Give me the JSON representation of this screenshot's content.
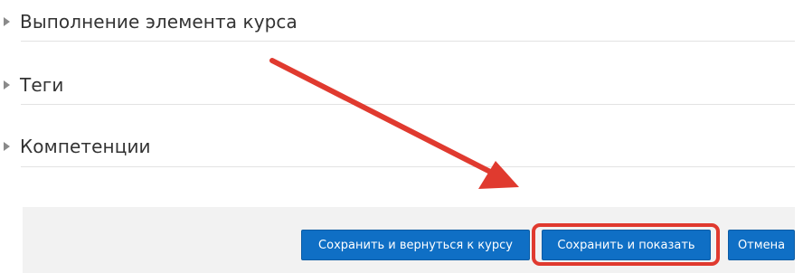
{
  "sections": [
    {
      "label": "Выполнение элемента курса",
      "expanded": false
    },
    {
      "label": "Теги",
      "expanded": false
    },
    {
      "label": "Компетенции",
      "expanded": false
    }
  ],
  "footer": {
    "save_return_label": "Сохранить и вернуться к курсу",
    "save_display_label": "Сохранить и показать",
    "cancel_label": "Отмена"
  },
  "annotation": {
    "highlighted_button": "save_display",
    "arrow_color": "#e03a2f"
  },
  "colors": {
    "button_primary": "#0f6fc5",
    "footer_bg": "#f2f2f2",
    "text": "#333333"
  }
}
